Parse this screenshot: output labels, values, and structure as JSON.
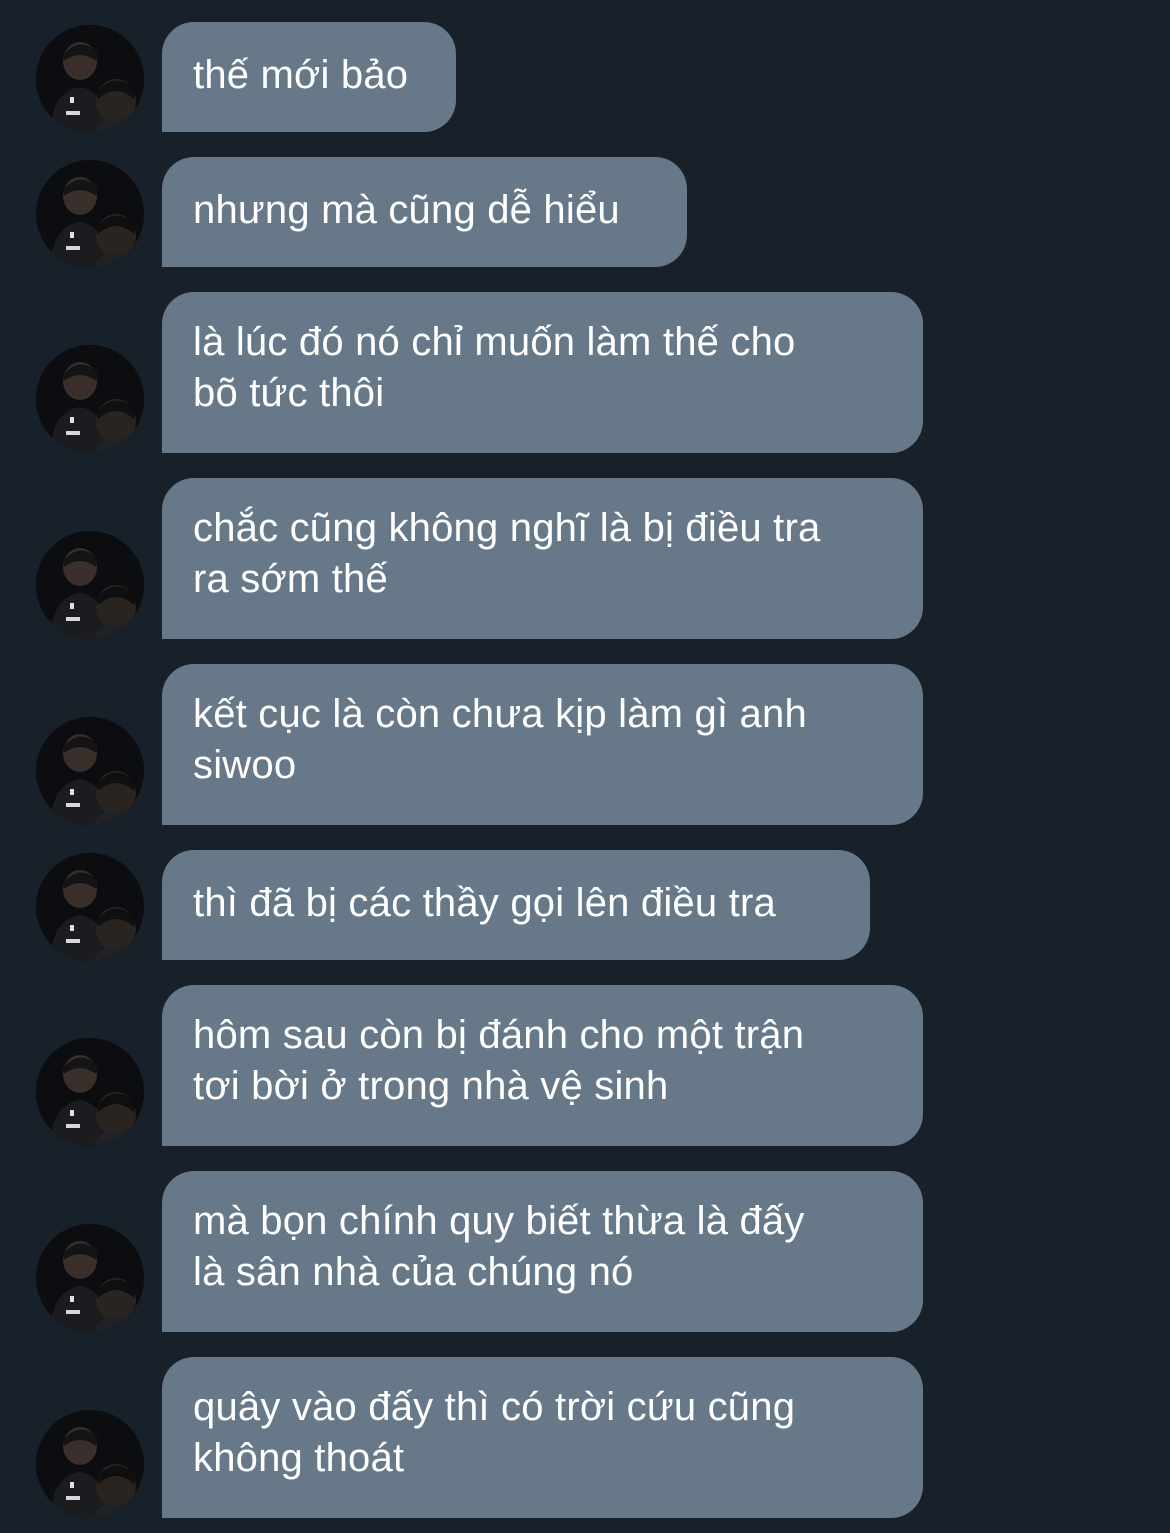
{
  "chat": {
    "messages": [
      {
        "text": "thế mới bảo",
        "lines": [
          "thế mới bảo"
        ]
      },
      {
        "text": "nhưng mà cũng dễ hiểu",
        "lines": [
          "nhưng mà cũng dễ hiểu"
        ]
      },
      {
        "text": "là lúc đó nó chỉ muốn làm thế cho bõ tức thôi",
        "lines": [
          "là lúc đó nó chỉ muốn làm thế cho",
          "bõ tức thôi"
        ]
      },
      {
        "text": "chắc cũng không nghĩ là bị điều tra ra sớm thế",
        "lines": [
          "chắc cũng không nghĩ là bị điều tra",
          "ra sớm thế"
        ]
      },
      {
        "text": "kết cục là còn chưa kịp làm gì anh siwoo",
        "lines": [
          "kết cục là còn chưa kịp làm gì anh",
          "siwoo"
        ]
      },
      {
        "text": "thì đã bị các thầy gọi lên điều tra",
        "lines": [
          "thì đã bị các thầy gọi lên điều tra"
        ]
      },
      {
        "text": "hôm sau còn bị đánh cho một trận tơi bời ở trong nhà vệ sinh",
        "lines": [
          "hôm sau còn bị đánh cho một trận",
          "tơi bời ở trong nhà vệ sinh"
        ]
      },
      {
        "text": "mà bọn chính quy biết thừa là đấy là sân nhà của chúng nó",
        "lines": [
          "mà bọn chính quy biết thừa là đấy",
          "là sân nhà của chúng nó"
        ]
      },
      {
        "text": "quây vào đấy thì có trời cứu cũng không thoát",
        "lines": [
          "quây vào đấy thì có trời cứu cũng",
          "không thoát"
        ]
      }
    ]
  },
  "colors": {
    "background": "#18202a",
    "bubble": "#677889",
    "text": "#ffffff"
  },
  "icons": {
    "avatar": "user-avatar-photo"
  }
}
